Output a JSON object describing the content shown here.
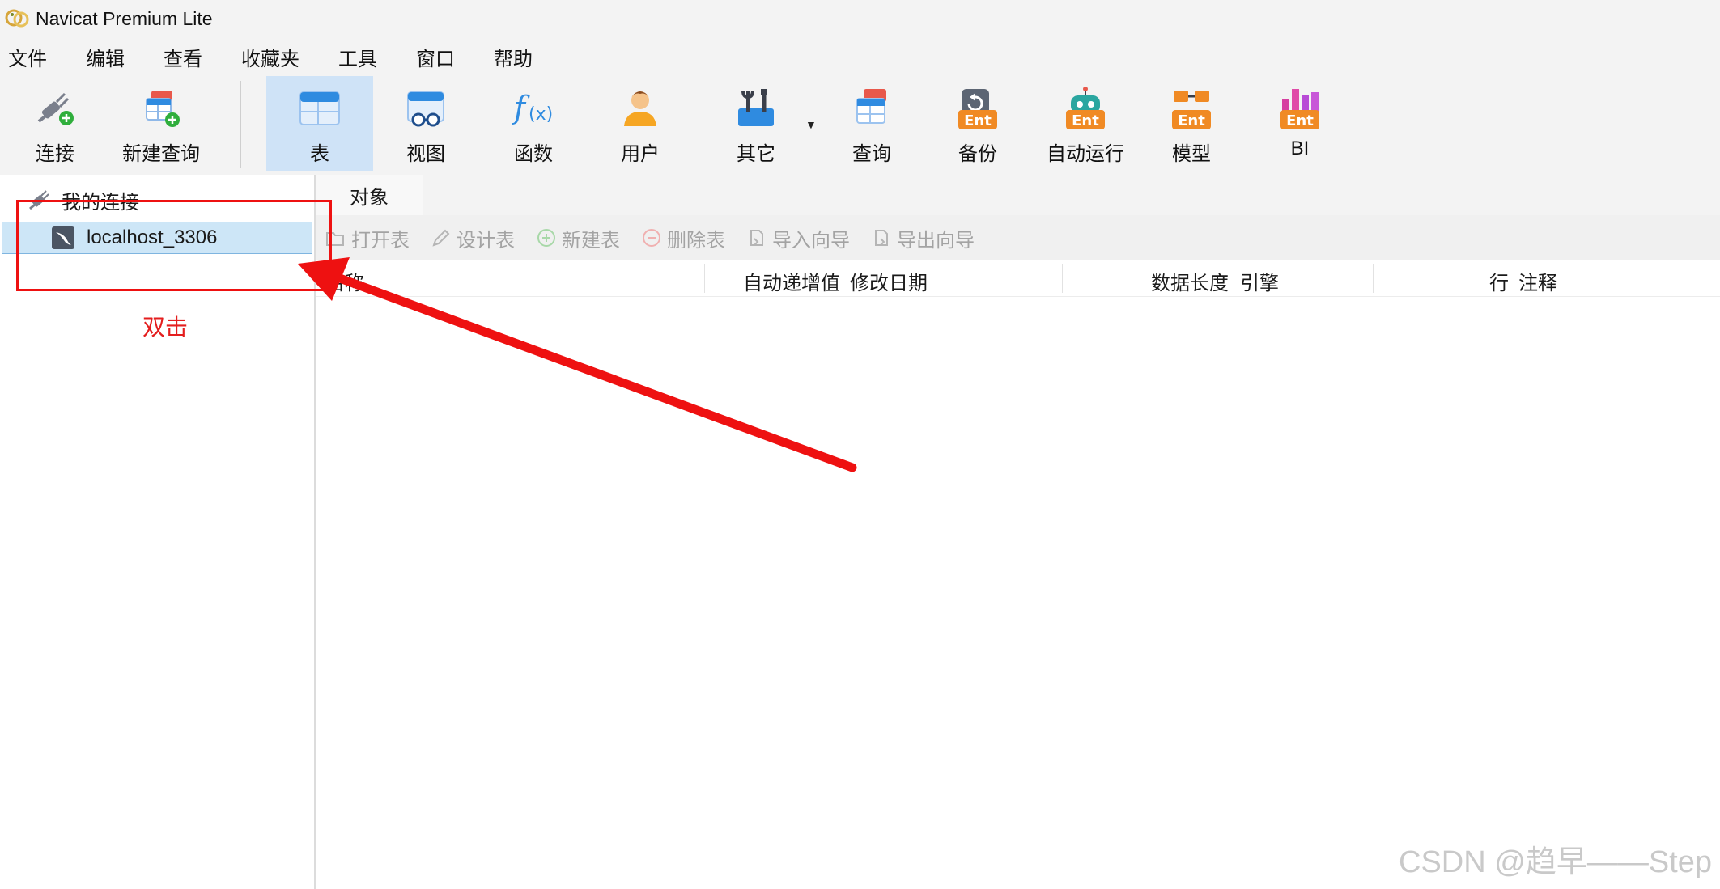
{
  "window": {
    "title": "Navicat Premium Lite"
  },
  "menu": [
    "文件",
    "编辑",
    "查看",
    "收藏夹",
    "工具",
    "窗口",
    "帮助"
  ],
  "toolbar": {
    "connect": "连接",
    "new_query": "新建查询",
    "table": "表",
    "view": "视图",
    "function": "函数",
    "user": "用户",
    "other": "其它",
    "query": "查询",
    "backup": "备份",
    "automation": "自动运行",
    "model": "模型",
    "bi": "BI",
    "ent_badge": "Ent"
  },
  "sidebar": {
    "root_label": "我的连接",
    "connection_label": "localhost_3306"
  },
  "tabs": {
    "objects": "对象"
  },
  "object_actions": [
    "打开表",
    "设计表",
    "新建表",
    "删除表",
    "导入向导",
    "导出向导"
  ],
  "columns": {
    "name": "名称",
    "auto_increment": "自动递增值",
    "modified": "修改日期",
    "data_length": "数据长度",
    "engine": "引擎",
    "rows": "行",
    "comment": "注释"
  },
  "annotation": {
    "text": "双击",
    "color": "#e41e1e"
  },
  "watermark": "CSDN @趋早——Step",
  "colors": {
    "selection": "#cde6f7",
    "active_tool": "#cfe3f7",
    "annotation": "#ee1111"
  }
}
